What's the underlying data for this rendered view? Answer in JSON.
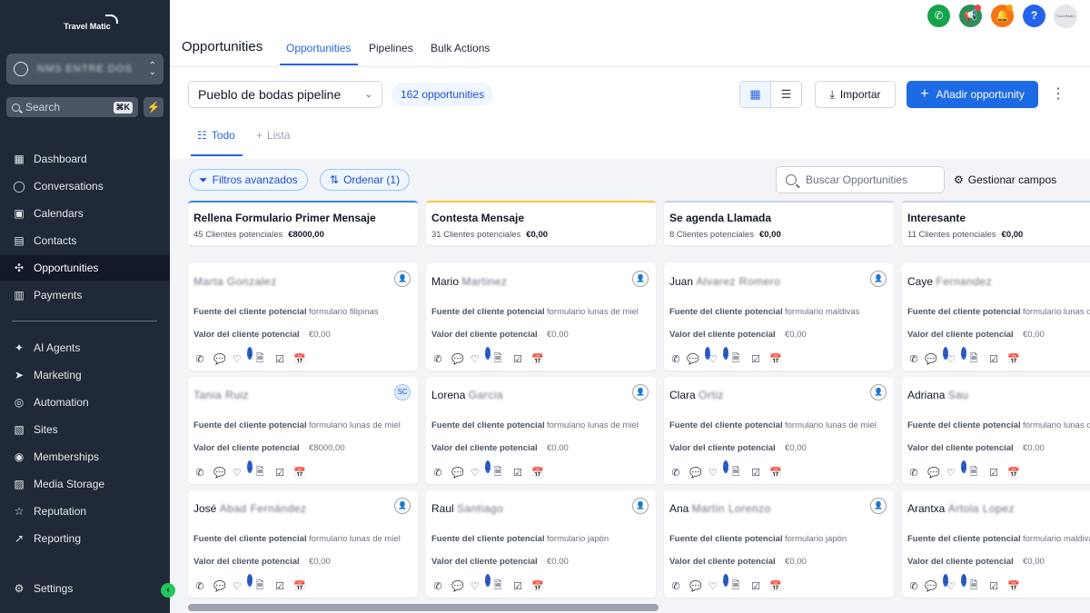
{
  "sidebar": {
    "logo": "Travel Matic",
    "account_name": "NMS ENTRE DOS",
    "search_placeholder": "Search",
    "search_shortcut": "⌘K",
    "nav": [
      {
        "label": "Dashboard",
        "icon": "dashboard-icon"
      },
      {
        "label": "Conversations",
        "icon": "chat-icon"
      },
      {
        "label": "Calendars",
        "icon": "calendar-icon"
      },
      {
        "label": "Contacts",
        "icon": "contacts-icon"
      },
      {
        "label": "Opportunities",
        "icon": "opportunities-icon",
        "active": true
      },
      {
        "label": "Payments",
        "icon": "payments-icon"
      },
      {
        "label": "AI Agents",
        "icon": "ai-agents-icon"
      },
      {
        "label": "Marketing",
        "icon": "marketing-icon"
      },
      {
        "label": "Automation",
        "icon": "automation-icon"
      },
      {
        "label": "Sites",
        "icon": "sites-icon"
      },
      {
        "label": "Memberships",
        "icon": "memberships-icon"
      },
      {
        "label": "Media Storage",
        "icon": "media-storage-icon"
      },
      {
        "label": "Reputation",
        "icon": "reputation-icon"
      },
      {
        "label": "Reporting",
        "icon": "reporting-icon"
      },
      {
        "label": "Settings",
        "icon": "settings-icon"
      }
    ]
  },
  "header": {
    "title": "Opportunities",
    "tabs": [
      "Opportunities",
      "Pipelines",
      "Bulk Actions"
    ],
    "active_tab": "Opportunities",
    "avatar_logo": "TravelMatic"
  },
  "toolbar": {
    "pipeline_value": "Pueblo de bodas pipeline",
    "count": "162 opportunities",
    "import_label": "Importar",
    "add_label": "Añadir opportunity",
    "subtabs": [
      "Todo",
      "Lista"
    ],
    "filters_label": "Filtros avanzados",
    "sort_label": "Ordenar (1)",
    "search_placeholder": "Buscar Opportunities",
    "manage_label": "Gestionar campos"
  },
  "colors": {
    "accent": "#2563eb",
    "sidebar_bg": "#1f2937",
    "col_blue": "#3b82f6",
    "col_yellow": "#f4c542",
    "col_gray": "#cbd5e1"
  },
  "field_labels": {
    "source": "Fuente del cliente potencial",
    "value": "Valor del cliente potencial"
  },
  "columns": [
    {
      "title": "Rellena Formulario Primer Mensaje",
      "leads": "45 Clientes potenciales",
      "amount": "€8000,00",
      "color": "#3b82f6",
      "cards": [
        {
          "first": "",
          "rest": "Marta Gonzalez",
          "source": "formulario filipinas",
          "value": "€0,00",
          "assignee": "user",
          "badges": {
            "msg": "",
            "heart": "1"
          }
        },
        {
          "first": "",
          "rest": "Tania Ruiz",
          "source": "formulario lunas de miel",
          "value": "€8000,00",
          "assignee": "SC",
          "badges": {
            "msg": "",
            "heart": "1"
          }
        },
        {
          "first": "José",
          "rest": "Abad Fernández",
          "source": "formulario lunas de miel",
          "value": "€0,00",
          "assignee": "user",
          "badges": {
            "msg": "",
            "heart": "2"
          }
        }
      ]
    },
    {
      "title": "Contesta Mensaje",
      "leads": "31 Clientes potenciales",
      "amount": "€0,00",
      "color": "#f4c542",
      "cards": [
        {
          "first": "Mario",
          "rest": "Martinez",
          "source": "formulario lunas de miel",
          "value": "€0,00",
          "assignee": "user",
          "badges": {
            "msg": "",
            "heart": "2"
          }
        },
        {
          "first": "Lorena",
          "rest": "Garcia",
          "source": "formulario lunas de miel",
          "value": "€0,00",
          "assignee": "user",
          "badges": {
            "msg": "",
            "heart": "2"
          }
        },
        {
          "first": "Raul",
          "rest": "Santiago",
          "source": "formulario japón",
          "value": "€0,00",
          "assignee": "user",
          "badges": {
            "msg": "",
            "heart": "2"
          }
        }
      ]
    },
    {
      "title": "Se agenda Llamada",
      "leads": "8 Clientes potenciales",
      "amount": "€0,00",
      "color": "#cbd5e1",
      "cards": [
        {
          "first": "Juan",
          "rest": "Alvarez Romero",
          "source": "formulario maldivas",
          "value": "€0,00",
          "assignee": "user",
          "badges": {
            "msg": "1",
            "heart": "2"
          }
        },
        {
          "first": "Clara",
          "rest": "Ortiz",
          "source": "formulario lunas de miel",
          "value": "€0,00",
          "assignee": "user",
          "badges": {
            "msg": "",
            "heart": "2"
          }
        },
        {
          "first": "Ana",
          "rest": "Martin Lorenzo",
          "source": "formulario japón",
          "value": "€0,00",
          "assignee": "user",
          "badges": {
            "msg": "",
            "heart": "2"
          }
        }
      ]
    },
    {
      "title": "Interesante",
      "leads": "11 Clientes potenciales",
      "amount": "€0,00",
      "color": "#cbd5e1",
      "cards": [
        {
          "first": "Caye",
          "rest": "Fernandez",
          "source": "formulario lunas de miel",
          "value": "€0,00",
          "assignee": "user",
          "badges": {
            "msg": "1",
            "heart": "2"
          }
        },
        {
          "first": "Adriana",
          "rest": "Sau",
          "source": "formulario lunas de miel",
          "value": "€0,00",
          "assignee": "user",
          "badges": {
            "msg": "",
            "heart": "2"
          }
        },
        {
          "first": "Arantxa",
          "rest": "Artola Lopez",
          "source": "formulario maldivas",
          "value": "€0,00",
          "assignee": "user",
          "badges": {
            "msg": "1",
            "heart": "2"
          }
        }
      ]
    }
  ]
}
